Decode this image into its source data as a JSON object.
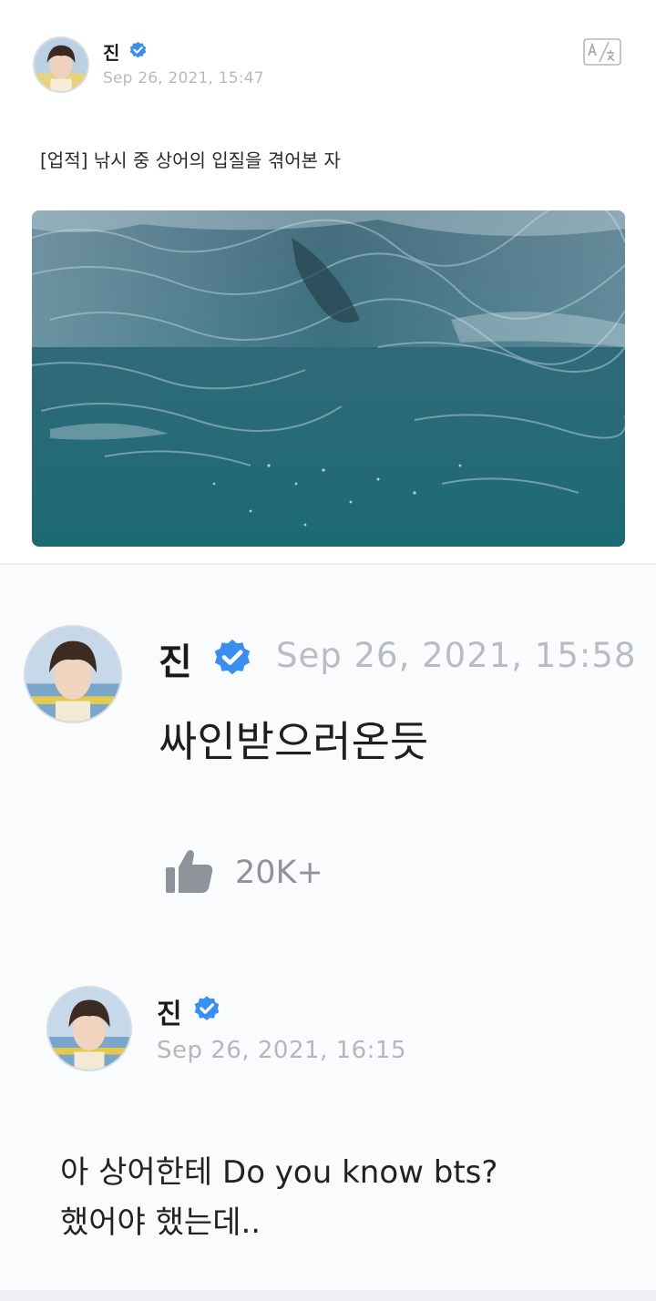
{
  "colors": {
    "verified": "#3a8ef0",
    "timestamp": "#b6bac2",
    "like": "#8e929a"
  },
  "post": {
    "author": "진",
    "verified_icon": "verified-check-icon",
    "timestamp": "Sep 26, 2021, 15:47",
    "translate_icon": "translate-icon",
    "text": "[업적] 낚시 중 상어의 입질을 겪어본 자"
  },
  "comment": {
    "author": "진",
    "verified_icon": "verified-check-icon",
    "timestamp": "Sep 26, 2021, 15:58",
    "text": "싸인받으러온듯",
    "like_icon": "thumbs-up-icon",
    "like_count": "20K+"
  },
  "reply": {
    "author": "진",
    "verified_icon": "verified-check-icon",
    "timestamp": "Sep 26, 2021, 16:15",
    "text_line1": "아 상어한테 Do you know bts?",
    "text_line2": "했어야 했는데.."
  }
}
